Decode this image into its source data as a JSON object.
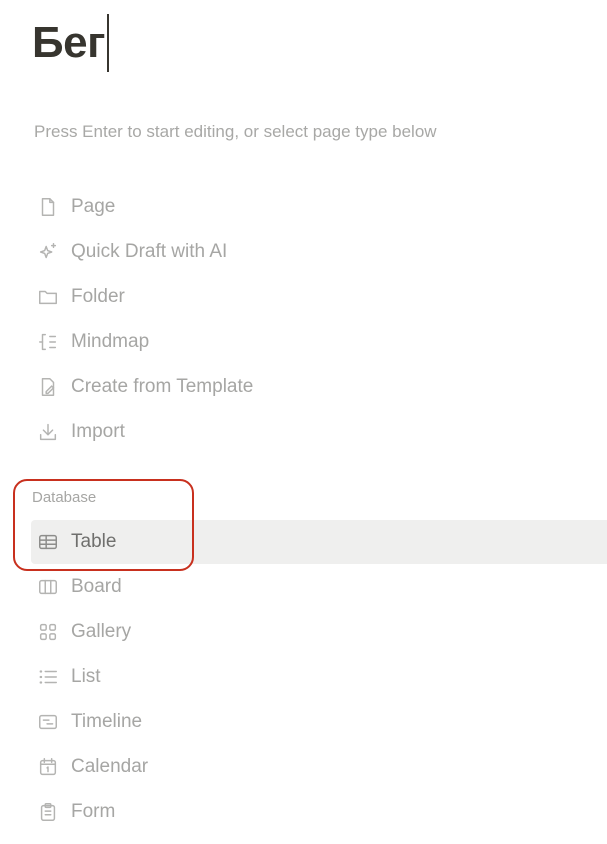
{
  "page": {
    "title": "Бег",
    "hint": "Press Enter to start editing, or select page type below"
  },
  "page_types": [
    {
      "label": "Page",
      "icon": "page-icon"
    },
    {
      "label": "Quick Draft with AI",
      "icon": "sparkle-icon"
    },
    {
      "label": "Folder",
      "icon": "folder-icon"
    },
    {
      "label": "Mindmap",
      "icon": "mindmap-icon"
    },
    {
      "label": "Create from Template",
      "icon": "template-icon"
    },
    {
      "label": "Import",
      "icon": "import-icon"
    }
  ],
  "database": {
    "section_label": "Database",
    "items": [
      {
        "label": "Table",
        "icon": "table-icon",
        "selected": true
      },
      {
        "label": "Board",
        "icon": "board-icon"
      },
      {
        "label": "Gallery",
        "icon": "gallery-icon"
      },
      {
        "label": "List",
        "icon": "list-icon"
      },
      {
        "label": "Timeline",
        "icon": "timeline-icon"
      },
      {
        "label": "Calendar",
        "icon": "calendar-icon"
      },
      {
        "label": "Form",
        "icon": "form-icon"
      }
    ]
  },
  "colors": {
    "text": "#37352f",
    "muted": "#a6a6a4",
    "selected_bg": "#efefee",
    "annotation": "#c8301e"
  }
}
